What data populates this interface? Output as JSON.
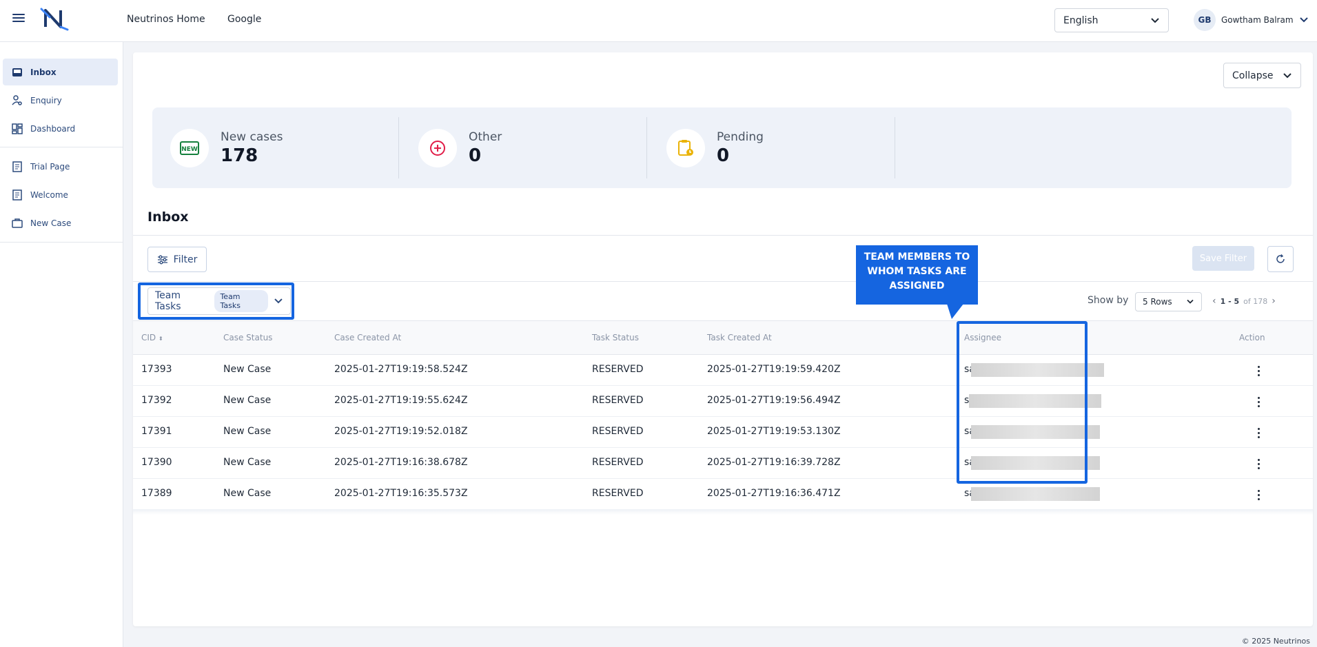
{
  "header": {
    "nav_links": [
      "Neutrinos Home",
      "Google"
    ],
    "language": "English",
    "user_initials": "GB",
    "user_name": "Gowtham Balram"
  },
  "sidebar": {
    "items": [
      {
        "label": "Inbox",
        "icon": "inbox-icon",
        "active": true
      },
      {
        "label": "Enquiry",
        "icon": "person-search-icon"
      },
      {
        "label": "Dashboard",
        "icon": "dashboard-icon"
      },
      {
        "label": "Trial Page",
        "icon": "page-icon"
      },
      {
        "label": "Welcome",
        "icon": "page-icon"
      },
      {
        "label": "New Case",
        "icon": "briefcase-icon"
      }
    ]
  },
  "main": {
    "collapse_label": "Collapse",
    "stats": [
      {
        "label": "New cases",
        "value": "178",
        "icon": "new-badge-icon"
      },
      {
        "label": "Other",
        "value": "0",
        "icon": "plus-circle-icon"
      },
      {
        "label": "Pending",
        "value": "0",
        "icon": "clipboard-clock-icon"
      }
    ],
    "section_title": "Inbox",
    "filter_label": "Filter",
    "save_filter_label": "Save Filter",
    "team_select": {
      "label": "Team Tasks",
      "chip": "Team Tasks"
    },
    "callout": "TEAM MEMBERS TO WHOM TASKS ARE ASSIGNED",
    "show_by_label": "Show by",
    "rows_option": "5 Rows",
    "pager": {
      "range": "1 - 5",
      "of_text": "of 178"
    },
    "table": {
      "columns": [
        "CID",
        "Case Status",
        "Case Created At",
        "Task Status",
        "Task Created At",
        "Assignee",
        "Action"
      ],
      "rows": [
        {
          "cid": "17393",
          "case_status": "New Case",
          "case_created": "2025-01-27T19:19:58.524Z",
          "task_status": "RESERVED",
          "task_created": "2025-01-27T19:19:59.420Z",
          "assignee": "sa"
        },
        {
          "cid": "17392",
          "case_status": "New Case",
          "case_created": "2025-01-27T19:19:55.624Z",
          "task_status": "RESERVED",
          "task_created": "2025-01-27T19:19:56.494Z",
          "assignee": "s"
        },
        {
          "cid": "17391",
          "case_status": "New Case",
          "case_created": "2025-01-27T19:19:52.018Z",
          "task_status": "RESERVED",
          "task_created": "2025-01-27T19:19:53.130Z",
          "assignee": "sa"
        },
        {
          "cid": "17390",
          "case_status": "New Case",
          "case_created": "2025-01-27T19:16:38.678Z",
          "task_status": "RESERVED",
          "task_created": "2025-01-27T19:16:39.728Z",
          "assignee": "sa"
        },
        {
          "cid": "17389",
          "case_status": "New Case",
          "case_created": "2025-01-27T19:16:35.573Z",
          "task_status": "RESERVED",
          "task_created": "2025-01-27T19:16:36.471Z",
          "assignee": "sa"
        }
      ]
    }
  },
  "footer": "© 2025 Neutrinos",
  "colors": {
    "accent": "#1565e0",
    "brand": "#1e3a6e"
  }
}
